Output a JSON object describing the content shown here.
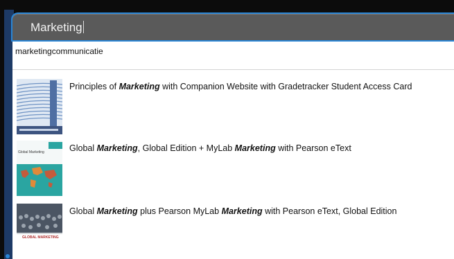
{
  "search": {
    "value": "Marketing"
  },
  "suggestion": {
    "text": "marketingcommunicatie"
  },
  "results": [
    {
      "title_parts": [
        "Principles of ",
        "Marketing",
        " with Companion Website with Gradetracker Student Access Card"
      ],
      "cover_icon": "book-cover-principles-of-marketing"
    },
    {
      "title_parts": [
        "Global ",
        "Marketing",
        ", Global Edition + MyLab ",
        "Marketing",
        " with Pearson eText"
      ],
      "cover_icon": "book-cover-global-marketing-map",
      "cover_label": "Global Marketing"
    },
    {
      "title_parts": [
        "Global ",
        "Marketing",
        " plus Pearson MyLab ",
        "Marketing",
        " with Pearson eText, Global Edition"
      ],
      "cover_icon": "book-cover-global-marketing-crowd",
      "cover_label": "GLOBAL MARKETING"
    }
  ],
  "colors": {
    "focus_border": "#2a86d6",
    "search_bg": "#5a5a5a",
    "dropdown_bg": "#ffffff"
  }
}
